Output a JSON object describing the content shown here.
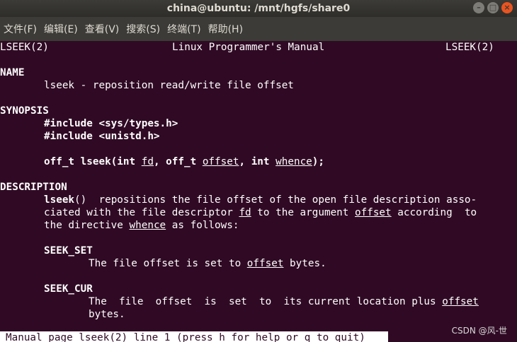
{
  "window": {
    "title": "china@ubuntu: /mnt/hgfs/share0"
  },
  "menu": [
    "文件(F)",
    "编辑(E)",
    "查看(V)",
    "搜索(S)",
    "终端(T)",
    "帮助(H)"
  ],
  "man": {
    "header_left": "LSEEK(2)",
    "header_center": "Linux Programmer's Manual",
    "header_right": "LSEEK(2)",
    "name_heading": "NAME",
    "name_text": "lseek - reposition read/write file offset",
    "synopsis_heading": "SYNOPSIS",
    "include1": "#include <sys/types.h>",
    "include2": "#include <unistd.h>",
    "proto": {
      "p1": "off_t lseek(int ",
      "fd": "fd",
      "p2": ", off_t ",
      "offset": "offset",
      "p3": ", int ",
      "whence": "whence",
      "p4": ");"
    },
    "description_heading": "DESCRIPTION",
    "desc1": {
      "fn": "lseek",
      "rest": "()  repositions the file offset of the open file description asso‐"
    },
    "desc2": {
      "a": "ciated with the file descriptor ",
      "fd": "fd",
      "b": " to the argument ",
      "offset": "offset",
      "c": " according  to"
    },
    "desc3": {
      "a": "the directive ",
      "whence": "whence",
      "b": " as follows:"
    },
    "seek_set": "SEEK_SET",
    "seek_set_text": {
      "a": "The file offset is set to ",
      "offset": "offset",
      "b": " bytes."
    },
    "seek_cur": "SEEK_CUR",
    "seek_cur_text": {
      "a": "The  file  offset  is  set  to  its current location plus ",
      "offset": "offset"
    },
    "seek_cur_text2": "bytes."
  },
  "status_line": "Manual page lseek(2) line 1 (press h for help or q to quit)",
  "watermark": "CSDN @风-世"
}
